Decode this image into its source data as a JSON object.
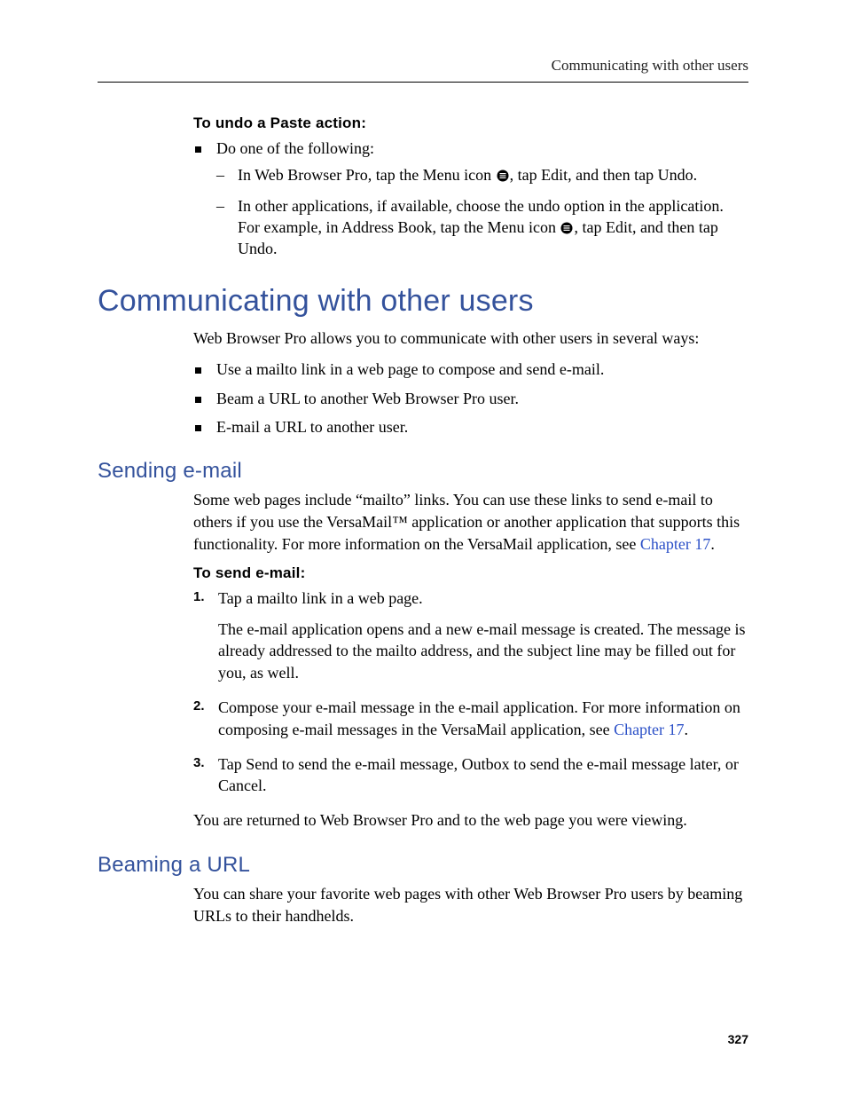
{
  "runningHead": "Communicating with other users",
  "undo": {
    "lead": "To undo a Paste action:",
    "bullet": "Do one of the following:",
    "dash1a": "In Web Browser Pro, tap the Menu icon ",
    "dash1b": ", tap Edit, and then tap Undo.",
    "dash2a": "In other applications, if available, choose the undo option in the application. For example, in Address Book, tap the Menu icon ",
    "dash2b": ", tap Edit, and then tap Undo."
  },
  "h1": "Communicating with other users",
  "intro": "Web Browser Pro allows you to communicate with other users in several ways:",
  "ways": {
    "b1": "Use a mailto link in a web page to compose and send e-mail.",
    "b2": "Beam a URL to another Web Browser Pro user.",
    "b3": "E-mail a URL to another user."
  },
  "sendH": "Sending e-mail",
  "sendP1a": "Some web pages include “mailto” links. You can use these links to send e-mail to others if you use the VersaMail™ application or another application that supports this functionality. For more information on the VersaMail application, see ",
  "sendP1Link": "Chapter 17",
  "sendP1b": ".",
  "sendLead": "To send e-mail:",
  "step1": "Tap a mailto link in a web page.",
  "step1p": "The e-mail application opens and a new e-mail message is created. The message is already addressed to the mailto address, and the subject line may be filled out for you, as well.",
  "step2a": "Compose your e-mail message in the e-mail application. For more information on composing e-mail messages in the VersaMail application, see ",
  "step2Link": "Chapter 17",
  "step2b": ".",
  "step3": "Tap Send to send the e-mail message, Outbox to send the e-mail message later, or Cancel.",
  "sendP2": "You are returned to Web Browser Pro and to the web page you were viewing.",
  "beamH": "Beaming a URL",
  "beamP": "You can share your favorite web pages with other Web Browser Pro users by beaming URLs to their handhelds.",
  "pageNum": "327"
}
